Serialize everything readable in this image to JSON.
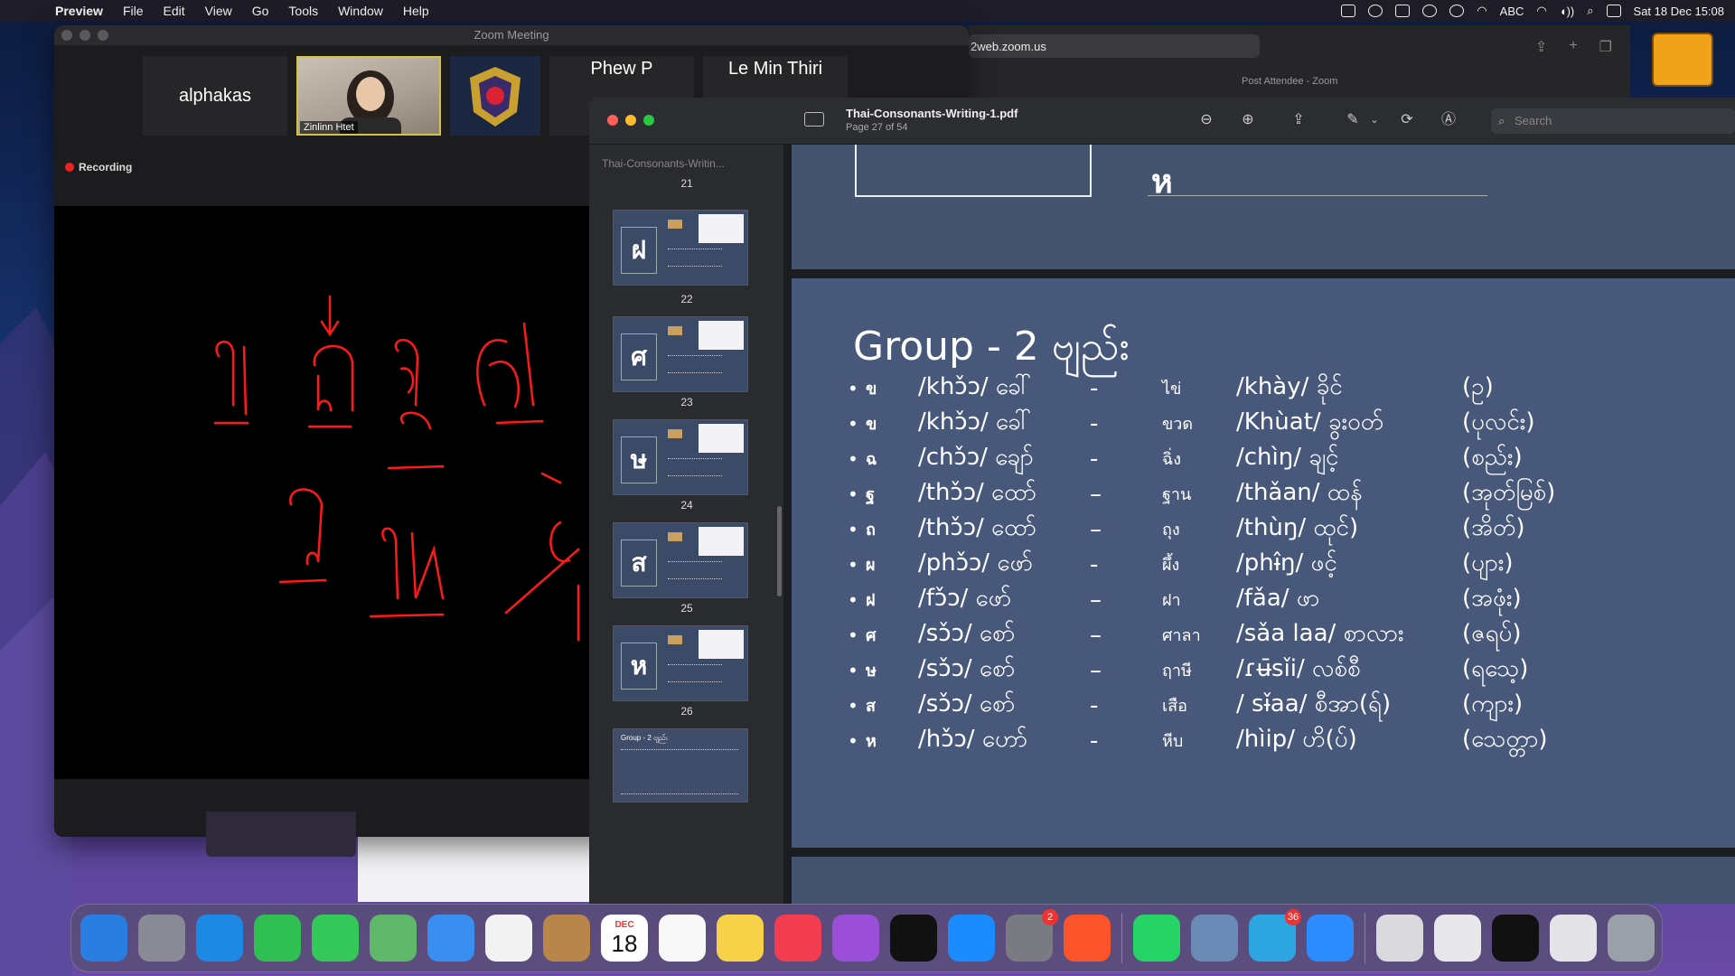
{
  "menubar": {
    "app_name": "Preview",
    "items": [
      "File",
      "Edit",
      "View",
      "Go",
      "Tools",
      "Window",
      "Help"
    ],
    "input_source": "ABC",
    "datetime": "Sat 18 Dec  15:08"
  },
  "zoom": {
    "window_title": "Zoom Meeting",
    "participants": [
      {
        "name": "alphakas"
      },
      {
        "name": "Zinlinn Htet"
      },
      {
        "name": "Phew P"
      },
      {
        "name": "Le Min Thiri"
      }
    ],
    "recording_label": "Recording"
  },
  "browser": {
    "url": "2web.zoom.us",
    "tab_label": "Post Attendee - Zoom"
  },
  "preview": {
    "doc_title": "Thai-Consonants-Writing-1.pdf",
    "page_info": "Page 27 of 54",
    "sidebar_doc_name": "Thai-Consonants-Writin...",
    "search_placeholder": "Search",
    "thumbnails": [
      {
        "num": "21",
        "glyph": ""
      },
      {
        "num": "22",
        "glyph": "ฝ"
      },
      {
        "num": "23",
        "glyph": "ศ"
      },
      {
        "num": "24",
        "glyph": "ษ"
      },
      {
        "num": "25",
        "glyph": "ส"
      },
      {
        "num": "26",
        "glyph": "ห"
      }
    ],
    "active_thumb_label": "Group - 2 ဗျည်း",
    "page_top_glyph": "ห",
    "slide": {
      "heading": "Group   - 2 ဗျည်း",
      "rows": [
        {
          "thai": "ข",
          "ipa": "/khɔ̌ɔ/ ခေါ်",
          "dash": "-",
          "word": "ไข่",
          "trans": "/khày/ ခိုင်",
          "meaning": "(ဥ)"
        },
        {
          "thai": "ข",
          "ipa": "/khɔ̌ɔ/ ခေါ်",
          "dash": "-",
          "word": "ขวด",
          "trans": "/Khùat/ ခွးဝတ်",
          "meaning": "(ပုလင်း)"
        },
        {
          "thai": "ฉ",
          "ipa": "/chɔ̌ɔ/ ချော်",
          "dash": "-",
          "word": "ฉิ่ง",
          "trans": "/chìŋ/ ချင့်",
          "meaning": "(စည်း)"
        },
        {
          "thai": "ฐ",
          "ipa": "/thɔ̌ɔ/ ထော်",
          "dash": "–",
          "word": "ฐาน",
          "trans": "/thǎan/ ထန်",
          "meaning": "(အုတ်မြစ်)"
        },
        {
          "thai": "ถ",
          "ipa": "/thɔ̌ɔ/  ထော်",
          "dash": "–",
          "word": "ถุง",
          "trans": "/thùŋ/ ထုင်)",
          "meaning": "(အိတ်)"
        },
        {
          "thai": "ผ",
          "ipa": "/phɔ̌ɔ/ ဖော်",
          "dash": "-",
          "word": "ผึ้ง",
          "trans": "/phɨ̂ŋ/ ဖင့်",
          "meaning": "(ပျား)"
        },
        {
          "thai": "ฝ",
          "ipa": "/fɔ̌ɔ/   ဖော်",
          "dash": "–",
          "word": "ฝา",
          "trans": "/fǎa/ ဖာ",
          "meaning": "(အဖုံး)"
        },
        {
          "thai": "ศ",
          "ipa": "/sɔ̌ɔ/  စော်",
          "dash": "–",
          "word": "ศาลา",
          "trans": "/sǎa laa/ စာလား",
          "meaning": "(ဇရပ်)"
        },
        {
          "thai": "ษ",
          "ipa": "/sɔ̌ɔ/  စော်",
          "dash": "–",
          "word": "ฤาษี",
          "trans": "/ɾʉ̄sǐi/ လစ်စီ",
          "meaning": "(ရသေ့)"
        },
        {
          "thai": "ส",
          "ipa": "/sɔ̌ɔ/  စော်",
          "dash": "-",
          "word": "เสือ",
          "trans": "/ sɨ̌aa/ စီအာ(ရ်)",
          "meaning": "(ကျား)"
        },
        {
          "thai": "ห",
          "ipa": "/hɔ̌ɔ/  ဟော်",
          "dash": "-",
          "word": "หีบ",
          "trans": "/hìip/ ဟိ(ပ်)",
          "meaning": "(သေတ္တာ)"
        }
      ]
    }
  },
  "dock": {
    "calendar_month": "DEC",
    "calendar_day": "18",
    "apps": [
      {
        "name": "finder",
        "color": "#2a7de1"
      },
      {
        "name": "launchpad",
        "color": "#8a8a96"
      },
      {
        "name": "safari",
        "color": "#1e88e5"
      },
      {
        "name": "facetime",
        "color": "#2fbf52"
      },
      {
        "name": "messages",
        "color": "#34c759"
      },
      {
        "name": "maps",
        "color": "#5fb86a"
      },
      {
        "name": "mail",
        "color": "#3a8ef0"
      },
      {
        "name": "photos",
        "color": "#f2f2f2"
      },
      {
        "name": "contacts",
        "color": "#b8864a"
      },
      {
        "name": "calendar",
        "color": "#ffffff"
      },
      {
        "name": "reminders",
        "color": "#f8f8f8"
      },
      {
        "name": "notes",
        "color": "#f7d248"
      },
      {
        "name": "music",
        "color": "#f23c50"
      },
      {
        "name": "podcasts",
        "color": "#9b4fd8"
      },
      {
        "name": "apple-tv",
        "color": "#111111"
      },
      {
        "name": "app-store",
        "color": "#1a8cff"
      },
      {
        "name": "system-preferences",
        "color": "#7a7a82"
      },
      {
        "name": "brave",
        "color": "#fb542b"
      },
      {
        "name": "sep",
        "color": ""
      },
      {
        "name": "whatsapp",
        "color": "#25d366"
      },
      {
        "name": "preview",
        "color": "#6a8bb5"
      },
      {
        "name": "telegram",
        "color": "#2ca5e0"
      },
      {
        "name": "zoom",
        "color": "#2d8cff"
      },
      {
        "name": "sep",
        "color": ""
      },
      {
        "name": "downloads-doc",
        "color": "#d9d9de"
      },
      {
        "name": "png-file",
        "color": "#e8e8ec"
      },
      {
        "name": "black-window",
        "color": "#111111"
      },
      {
        "name": "document-stack",
        "color": "#e4e4e8"
      },
      {
        "name": "trash",
        "color": "#9aa0a8"
      }
    ],
    "badges": {
      "system-preferences": "2",
      "telegram": "36"
    }
  }
}
